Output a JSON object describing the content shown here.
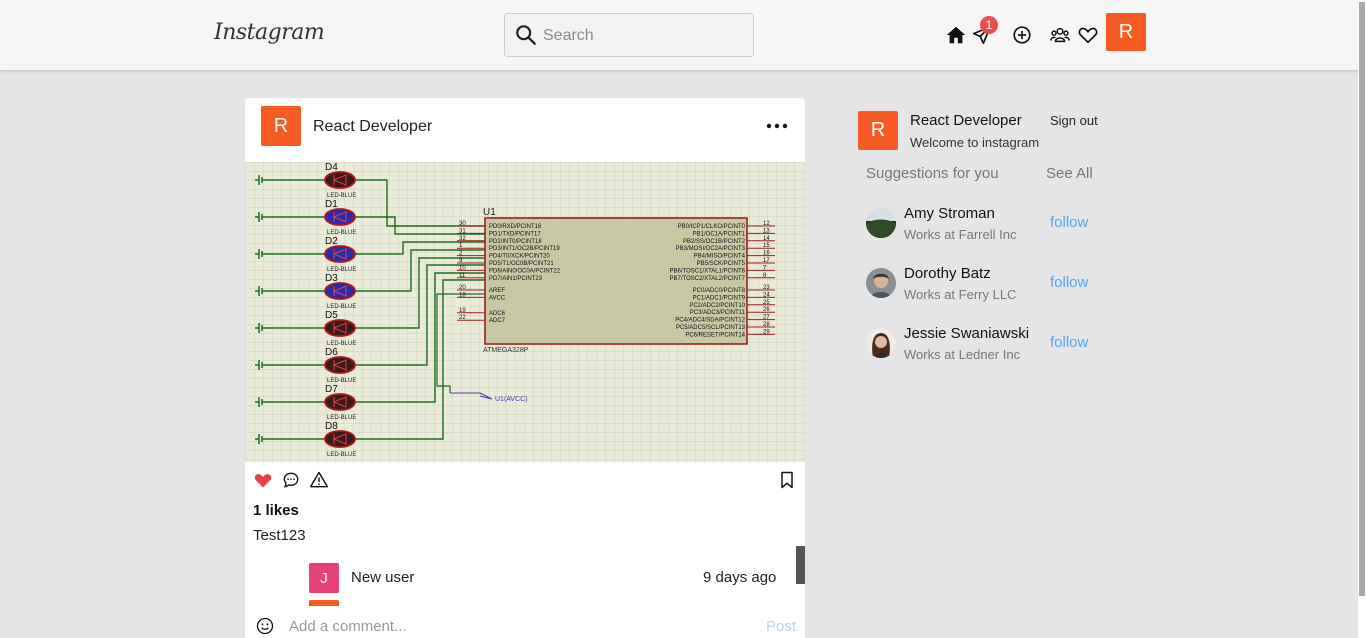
{
  "header": {
    "logo": "Instagram",
    "search_placeholder": "Search",
    "notification_count": "1",
    "avatar_letter": "R"
  },
  "post": {
    "author": "React Developer",
    "author_initial": "R",
    "schematic": {
      "leds": [
        {
          "ref": "D4",
          "type": "LED-BLUE"
        },
        {
          "ref": "D1",
          "type": "LED-BLUE"
        },
        {
          "ref": "D2",
          "type": "LED-BLUE"
        },
        {
          "ref": "D3",
          "type": "LED-BLUE"
        },
        {
          "ref": "D5",
          "type": "LED-BLUE"
        },
        {
          "ref": "D6",
          "type": "LED-BLUE"
        },
        {
          "ref": "D7",
          "type": "LED-BLUE"
        },
        {
          "ref": "D8",
          "type": "LED-BLUE"
        }
      ],
      "chip_ref": "U1",
      "chip_name": "ATMEGA328P",
      "net_label": "U1(AVCC)",
      "left_pins": [
        {
          "num": "30",
          "name": "PD0/RXD/PCINT16"
        },
        {
          "num": "31",
          "name": "PD1/TXD/PCINT17"
        },
        {
          "num": "32",
          "name": "PD2/INT0/PCINT18"
        },
        {
          "num": "1",
          "name": "PD3/INT1/OC2B/PCINT19"
        },
        {
          "num": "2",
          "name": "PD4/T0/XCK/PCINT20"
        },
        {
          "num": "9",
          "name": "PD5/T1/OC0B/PCINT21"
        },
        {
          "num": "10",
          "name": "PD6/AIN0/OC0A/PCINT22"
        },
        {
          "num": "11",
          "name": "PD7/AIN1/PCINT23"
        },
        {
          "num": "20",
          "name": "AREF"
        },
        {
          "num": "18",
          "name": "AVCC"
        },
        {
          "num": "19",
          "name": "ADC6"
        },
        {
          "num": "22",
          "name": "ADC7"
        }
      ],
      "right_pins": [
        {
          "num": "12",
          "name": "PB0/ICP1/CLKO/PCINT0"
        },
        {
          "num": "13",
          "name": "PB1/OC1A/PCINT1"
        },
        {
          "num": "14",
          "name": "PB2/SS/OC1B/PCINT2"
        },
        {
          "num": "15",
          "name": "PB3/MOSI/OC2A/PCINT3"
        },
        {
          "num": "16",
          "name": "PB4/MISO/PCINT4"
        },
        {
          "num": "17",
          "name": "PB5/SCK/PCINT5"
        },
        {
          "num": "7",
          "name": "PB6/TOSC1/XTAL1/PCINT6"
        },
        {
          "num": "8",
          "name": "PB7/TOSC2/XTAL2/PCINT7"
        },
        {
          "num": "23",
          "name": "PC0/ADC0/PCINT8"
        },
        {
          "num": "24",
          "name": "PC1/ADC1/PCINT9"
        },
        {
          "num": "25",
          "name": "PC2/ADC2/PCINT10"
        },
        {
          "num": "26",
          "name": "PC3/ADC3/PCINT11"
        },
        {
          "num": "27",
          "name": "PC4/ADC4/SDA/PCINT12"
        },
        {
          "num": "28",
          "name": "PC5/ADC5/SCL/PCINT13"
        },
        {
          "num": "29",
          "name": "PC6/RESET/PCINT14"
        }
      ]
    },
    "likes": "1 likes",
    "caption": "Test123",
    "comments": [
      {
        "initial": "J",
        "user": "New user",
        "time": "9 days ago",
        "color": "#e5427a"
      }
    ],
    "comment_placeholder": "Add a comment...",
    "post_button": "Post"
  },
  "sidebar": {
    "user_name": "React Developer",
    "user_initial": "R",
    "welcome": "Welcome to instagram",
    "sign_out": "Sign out",
    "suggestions_title": "Suggestions for you",
    "see_all": "See All",
    "suggestions": [
      {
        "name": "Amy Stroman",
        "work": "Works at Farrell Inc",
        "action": "follow"
      },
      {
        "name": "Dorothy Batz",
        "work": "Works at Ferry LLC",
        "action": "follow"
      },
      {
        "name": "Jessie Swaniawski",
        "work": "Works at Ledner Inc",
        "action": "follow"
      }
    ]
  },
  "colors": {
    "brand_avatar": "#f75b24",
    "like_heart": "#e8414b",
    "follow_link": "#53a7f3",
    "comment_avatar": "#e5427a"
  }
}
